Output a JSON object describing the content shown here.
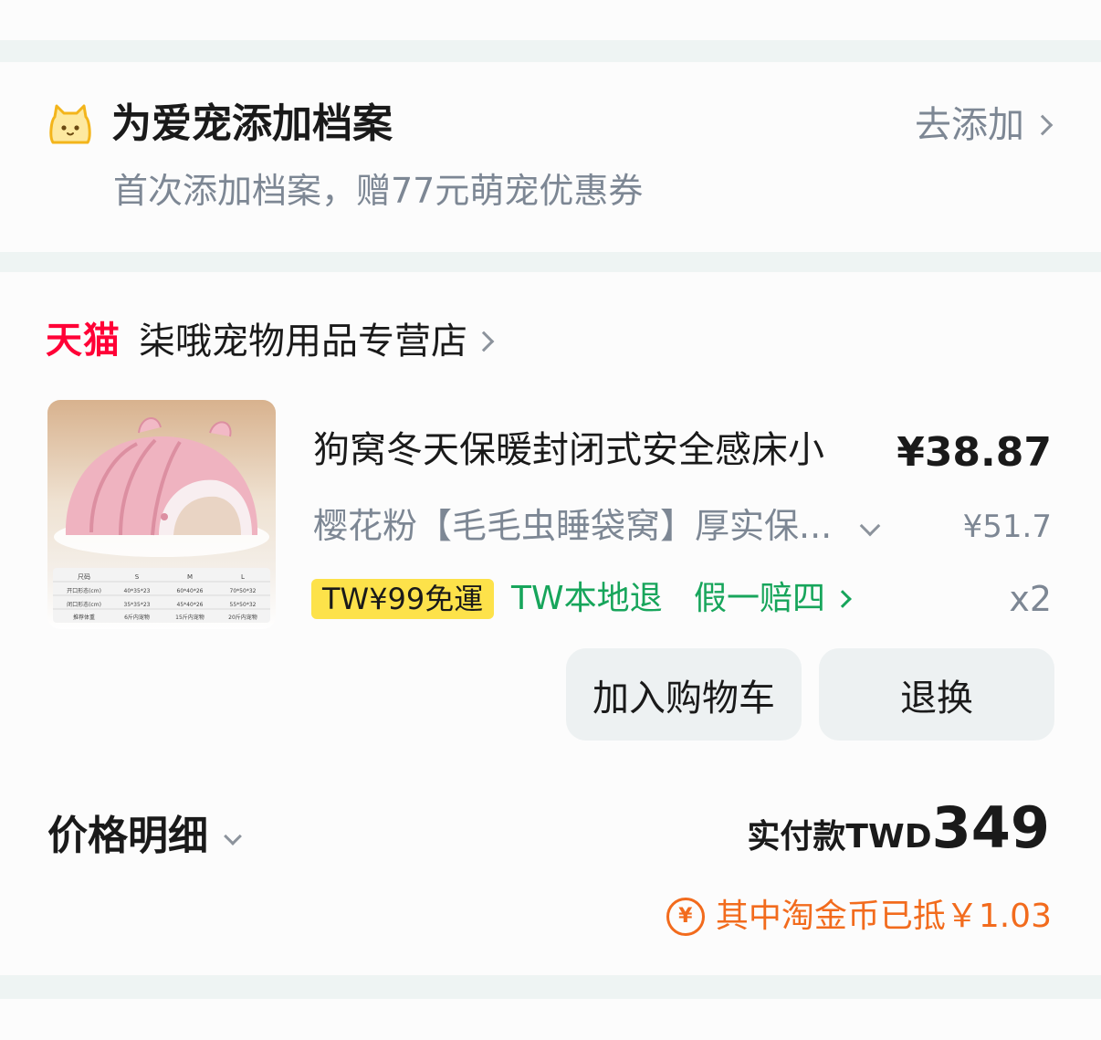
{
  "pet_banner": {
    "title": "为爱宠添加档案",
    "subtitle": "首次添加档案，赠77元萌宠优惠券",
    "action": "去添加"
  },
  "store": {
    "badge": "天猫",
    "name": "柒哦宠物用品专营店"
  },
  "product": {
    "title": "狗窝冬天保暖封闭式安全感床小",
    "price": "¥38.87",
    "sku": "樱花粉【毛毛虫睡袋窝】厚实保...",
    "original_price": "¥51.7",
    "shipping_tag": "TW¥99免運",
    "local_return": "TW本地退",
    "guarantee": "假一赔四",
    "quantity": "x2",
    "size_table": {
      "header": [
        "尺码",
        "S",
        "M",
        "L"
      ],
      "rows": [
        [
          "开口形态(cm)",
          "40*35*23",
          "60*40*26",
          "70*50*32"
        ],
        [
          "闭口形态(cm)",
          "35*35*23",
          "45*40*26",
          "55*50*32"
        ],
        [
          "推荐体重",
          "6斤内宠物",
          "15斤内宠物",
          "20斤内宠物"
        ]
      ]
    }
  },
  "actions": {
    "add_to_cart": "加入购物车",
    "return_exchange": "退换"
  },
  "summary": {
    "price_detail": "价格明细",
    "paid_label": "实付款TWD",
    "paid_amount": "349",
    "coin_note": "其中淘金币已抵￥1.03",
    "coin_symbol": "¥"
  },
  "colors": {
    "tmall_red": "#ff0036",
    "shipping_yellow": "#fde24a",
    "green": "#17a55b",
    "coin_orange": "#f26b1d",
    "muted_text": "#7d8794",
    "button_bg": "#edf1f2"
  },
  "icons": {
    "pet": "cat-face-icon",
    "chevron_right": "chevron-right-icon",
    "chevron_down": "chevron-down-icon",
    "coin": "yen-coin-icon"
  }
}
